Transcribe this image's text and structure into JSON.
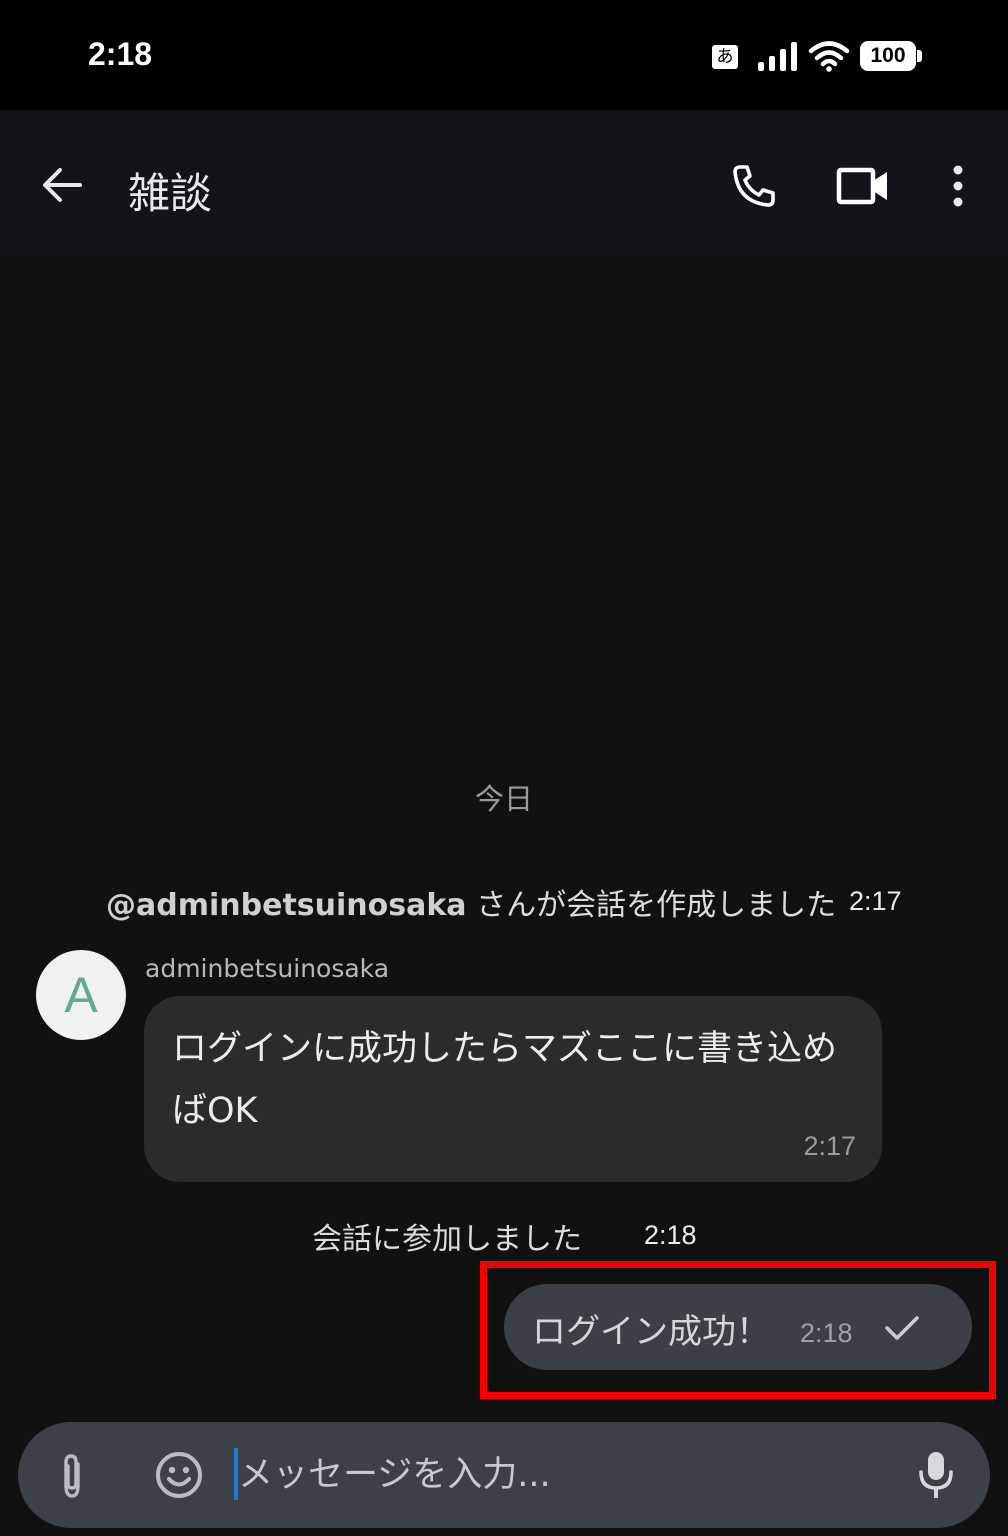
{
  "status_bar": {
    "time": "2:18",
    "ime": "あ",
    "battery": "100"
  },
  "app_bar": {
    "title": "雑談"
  },
  "chat": {
    "date_separator": "今日",
    "system_created": {
      "user": "@adminbetsuinosaka",
      "text": " さんが会話を作成しました",
      "time": "2:17"
    },
    "incoming_message": {
      "avatar_letter": "A",
      "sender": "adminbetsuinosaka",
      "text": "ログインに成功したらマズここに書き込めばOK",
      "time": "2:17"
    },
    "system_joined": {
      "text": "会話に参加しました",
      "time": "2:18"
    },
    "outgoing_message": {
      "text": "ログイン成功！",
      "time": "2:18"
    }
  },
  "input_bar": {
    "placeholder": "メッセージを入力..."
  },
  "colors": {
    "background": "#111112",
    "app_bar": "#121419",
    "incoming_bubble": "#2b2b2c",
    "outgoing_bubble": "#3b3f46",
    "highlight": "#f40000",
    "caret": "#1a7bd4"
  }
}
